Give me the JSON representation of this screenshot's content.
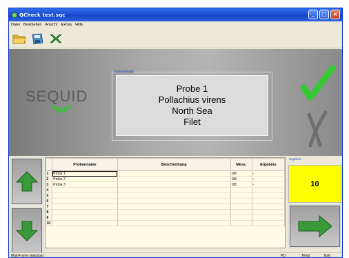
{
  "window": {
    "title": "QCheck test.sqc"
  },
  "menu": [
    "Datei",
    "Bearbeiten",
    "Ansicht",
    "Extras",
    "Hilfe"
  ],
  "toolbar": {
    "icons": [
      "open-folder-icon",
      "save-disk-icon",
      "tools-icon"
    ]
  },
  "logo": {
    "text": "SEQUID"
  },
  "details": {
    "legend": "Probendetails",
    "line1": "Probe 1",
    "line2": "Pollachius virens",
    "line3": "North Sea",
    "line4": "Filet"
  },
  "table": {
    "headers": {
      "name": "Probenname",
      "desc": "Beschreibung",
      "mess": "Mess.",
      "erg": "Ergebnis"
    },
    "rows": [
      {
        "num": "1",
        "name": "Probe 1",
        "desc": "",
        "mess": "0/8",
        "erg": "-"
      },
      {
        "num": "2",
        "name": "Probe 2",
        "desc": "",
        "mess": "0/8",
        "erg": "-"
      },
      {
        "num": "3",
        "name": "Probe 3",
        "desc": "",
        "mess": "0/8",
        "erg": "-"
      },
      {
        "num": "4",
        "name": "",
        "desc": "",
        "mess": "",
        "erg": ""
      },
      {
        "num": "5",
        "name": "",
        "desc": "",
        "mess": "",
        "erg": ""
      },
      {
        "num": "6",
        "name": "",
        "desc": "",
        "mess": "",
        "erg": ""
      },
      {
        "num": "7",
        "name": "",
        "desc": "",
        "mess": "",
        "erg": ""
      },
      {
        "num": "8",
        "name": "",
        "desc": "",
        "mess": "",
        "erg": ""
      },
      {
        "num": "9",
        "name": "",
        "desc": "",
        "mess": "",
        "erg": ""
      },
      {
        "num": "10",
        "name": "",
        "desc": "",
        "mess": "",
        "erg": ""
      }
    ]
  },
  "result": {
    "legend": "Ergebnis",
    "value": "10"
  },
  "status": {
    "left": "MainFrame  statusbar",
    "pd": "PD",
    "temp": "Temp",
    "batt": "Batt"
  },
  "colors": {
    "check": "#3cc83c",
    "result_bg": "#ffff00",
    "arrow": "#3a9a3a"
  }
}
